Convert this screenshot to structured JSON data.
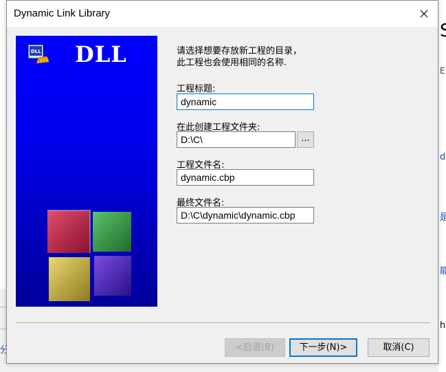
{
  "window": {
    "title": "Dynamic Link Library"
  },
  "banner": {
    "logo_text": "DLL"
  },
  "description": {
    "line1": "请选择想要存放新工程的目录，",
    "line2": "此工程也会使用相同的名称."
  },
  "fields": {
    "project_title": {
      "label": "工程标题:",
      "value": "dynamic"
    },
    "folder": {
      "label": "在此创建工程文件夹:",
      "value": "D:\\C\\",
      "browse_label": "..."
    },
    "project_filename": {
      "label": "工程文件名:",
      "value": "dynamic.cbp"
    },
    "result_filename": {
      "label": "最终文件名:",
      "value": "D:\\C\\dynamic\\dynamic.cbp"
    }
  },
  "buttons": {
    "back": "<后退(B)",
    "next": "下一步(N)>",
    "cancel": "取消(C)"
  },
  "background": {
    "frag_s": "S",
    "frag_e": "E",
    "frag_d": "d",
    "frag_cn1": "是",
    "frag_cn2": "能",
    "frag_h": "h",
    "frag_left": "分"
  }
}
